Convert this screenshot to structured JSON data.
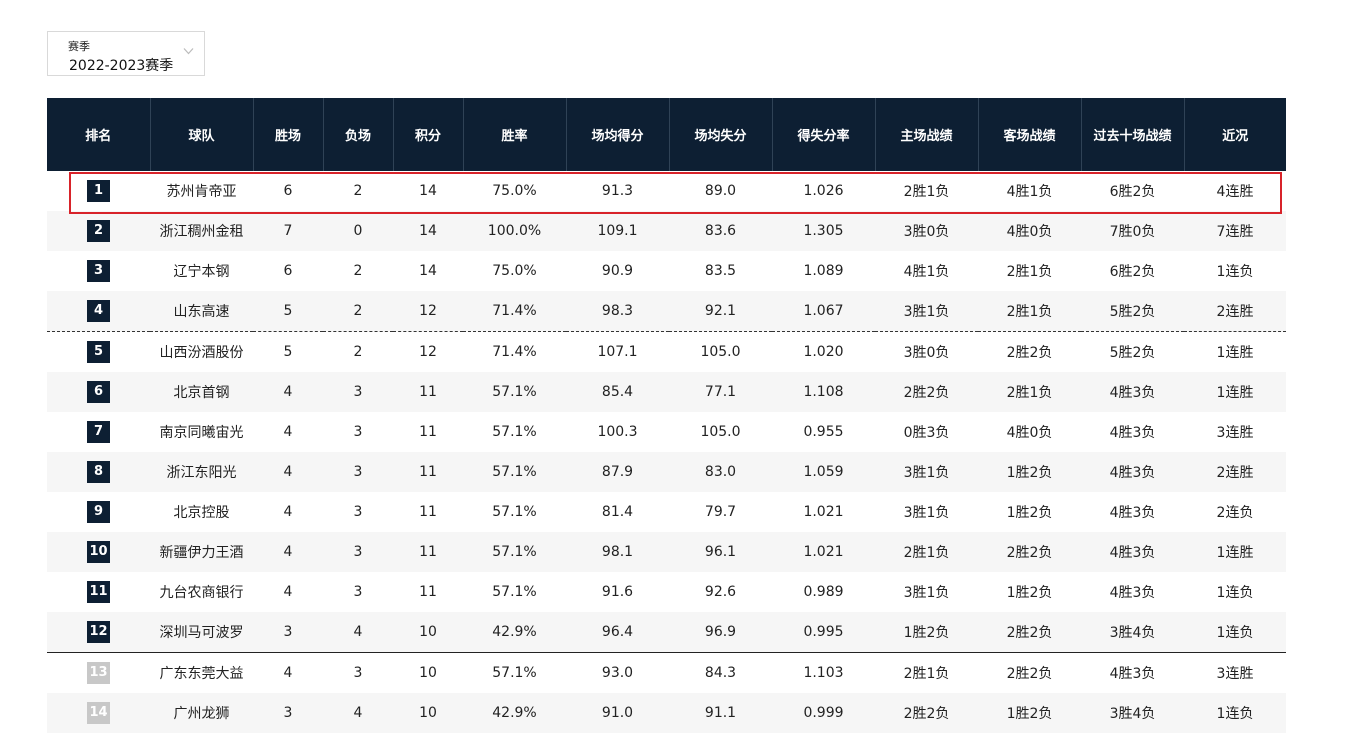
{
  "season": {
    "label": "赛季",
    "value": "2022-2023赛季"
  },
  "table": {
    "headers": [
      "排名",
      "球队",
      "胜场",
      "负场",
      "积分",
      "胜率",
      "场均得分",
      "场均失分",
      "得失分率",
      "主场战绩",
      "客场战绩",
      "过去十场战绩",
      "近况"
    ],
    "rows": [
      {
        "rank": "1",
        "team": "苏州肯帝亚",
        "w": "6",
        "l": "2",
        "pts": "14",
        "pct": "75.0%",
        "ppg": "91.3",
        "papg": "89.0",
        "ratio": "1.026",
        "home": "2胜1负",
        "away": "4胜1负",
        "last10": "6胜2负",
        "streak": "4连胜"
      },
      {
        "rank": "2",
        "team": "浙江稠州金租",
        "w": "7",
        "l": "0",
        "pts": "14",
        "pct": "100.0%",
        "ppg": "109.1",
        "papg": "83.6",
        "ratio": "1.305",
        "home": "3胜0负",
        "away": "4胜0负",
        "last10": "7胜0负",
        "streak": "7连胜"
      },
      {
        "rank": "3",
        "team": "辽宁本钢",
        "w": "6",
        "l": "2",
        "pts": "14",
        "pct": "75.0%",
        "ppg": "90.9",
        "papg": "83.5",
        "ratio": "1.089",
        "home": "4胜1负",
        "away": "2胜1负",
        "last10": "6胜2负",
        "streak": "1连负"
      },
      {
        "rank": "4",
        "team": "山东高速",
        "w": "5",
        "l": "2",
        "pts": "12",
        "pct": "71.4%",
        "ppg": "98.3",
        "papg": "92.1",
        "ratio": "1.067",
        "home": "3胜1负",
        "away": "2胜1负",
        "last10": "5胜2负",
        "streak": "2连胜"
      },
      {
        "rank": "5",
        "team": "山西汾酒股份",
        "w": "5",
        "l": "2",
        "pts": "12",
        "pct": "71.4%",
        "ppg": "107.1",
        "papg": "105.0",
        "ratio": "1.020",
        "home": "3胜0负",
        "away": "2胜2负",
        "last10": "5胜2负",
        "streak": "1连胜"
      },
      {
        "rank": "6",
        "team": "北京首钢",
        "w": "4",
        "l": "3",
        "pts": "11",
        "pct": "57.1%",
        "ppg": "85.4",
        "papg": "77.1",
        "ratio": "1.108",
        "home": "2胜2负",
        "away": "2胜1负",
        "last10": "4胜3负",
        "streak": "1连胜"
      },
      {
        "rank": "7",
        "team": "南京同曦宙光",
        "w": "4",
        "l": "3",
        "pts": "11",
        "pct": "57.1%",
        "ppg": "100.3",
        "papg": "105.0",
        "ratio": "0.955",
        "home": "0胜3负",
        "away": "4胜0负",
        "last10": "4胜3负",
        "streak": "3连胜"
      },
      {
        "rank": "8",
        "team": "浙江东阳光",
        "w": "4",
        "l": "3",
        "pts": "11",
        "pct": "57.1%",
        "ppg": "87.9",
        "papg": "83.0",
        "ratio": "1.059",
        "home": "3胜1负",
        "away": "1胜2负",
        "last10": "4胜3负",
        "streak": "2连胜"
      },
      {
        "rank": "9",
        "team": "北京控股",
        "w": "4",
        "l": "3",
        "pts": "11",
        "pct": "57.1%",
        "ppg": "81.4",
        "papg": "79.7",
        "ratio": "1.021",
        "home": "3胜1负",
        "away": "1胜2负",
        "last10": "4胜3负",
        "streak": "2连负"
      },
      {
        "rank": "10",
        "team": "新疆伊力王酒",
        "w": "4",
        "l": "3",
        "pts": "11",
        "pct": "57.1%",
        "ppg": "98.1",
        "papg": "96.1",
        "ratio": "1.021",
        "home": "2胜1负",
        "away": "2胜2负",
        "last10": "4胜3负",
        "streak": "1连胜"
      },
      {
        "rank": "11",
        "team": "九台农商银行",
        "w": "4",
        "l": "3",
        "pts": "11",
        "pct": "57.1%",
        "ppg": "91.6",
        "papg": "92.6",
        "ratio": "0.989",
        "home": "3胜1负",
        "away": "1胜2负",
        "last10": "4胜3负",
        "streak": "1连负"
      },
      {
        "rank": "12",
        "team": "深圳马可波罗",
        "w": "3",
        "l": "4",
        "pts": "10",
        "pct": "42.9%",
        "ppg": "96.4",
        "papg": "96.9",
        "ratio": "0.995",
        "home": "1胜2负",
        "away": "2胜2负",
        "last10": "3胜4负",
        "streak": "1连负"
      },
      {
        "rank": "13",
        "team": "广东东莞大益",
        "w": "4",
        "l": "3",
        "pts": "10",
        "pct": "57.1%",
        "ppg": "93.0",
        "papg": "84.3",
        "ratio": "1.103",
        "home": "2胜1负",
        "away": "2胜2负",
        "last10": "4胜3负",
        "streak": "3连胜"
      },
      {
        "rank": "14",
        "team": "广州龙狮",
        "w": "3",
        "l": "4",
        "pts": "10",
        "pct": "42.9%",
        "ppg": "91.0",
        "papg": "91.1",
        "ratio": "0.999",
        "home": "2胜2负",
        "away": "1胜2负",
        "last10": "3胜4负",
        "streak": "1连负"
      }
    ]
  },
  "colors": {
    "header_bg": "#0d1f33",
    "highlight": "#d8232a",
    "badge_muted": "#c8c8c8"
  }
}
